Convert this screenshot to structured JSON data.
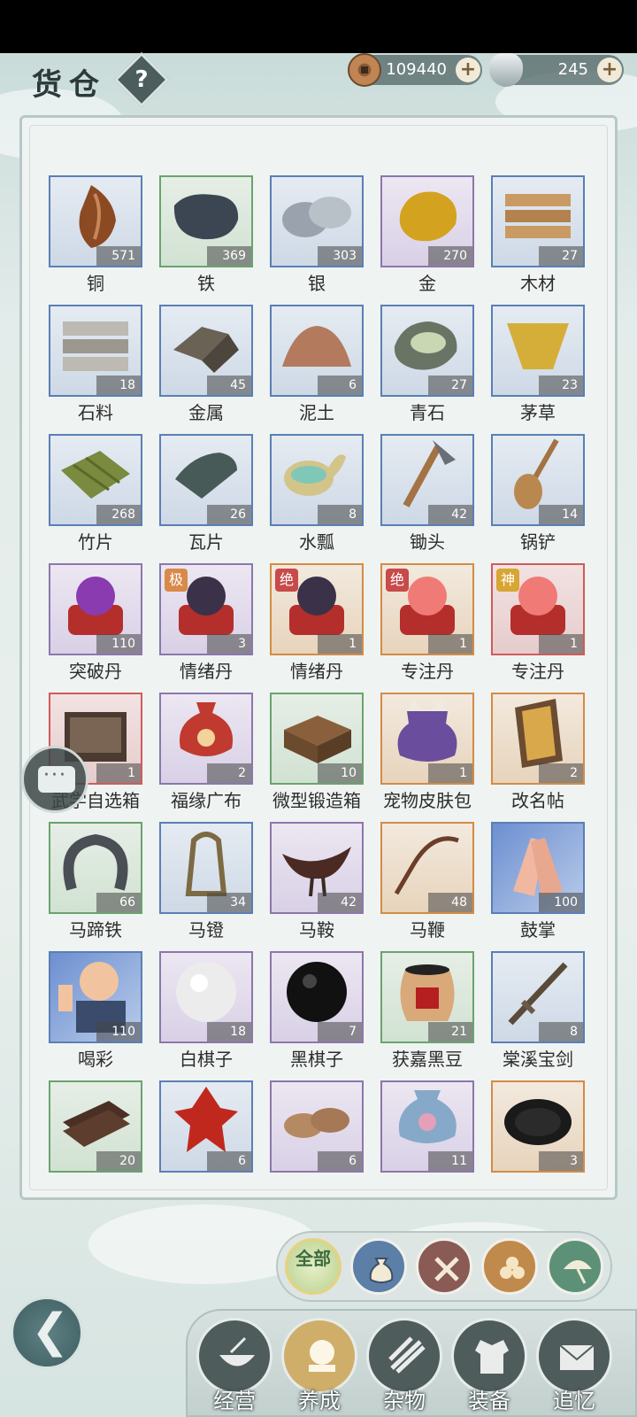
{
  "header": {
    "title": "货仓",
    "help_label": "?"
  },
  "currency": {
    "copper": {
      "icon": "copper-coin-icon",
      "value": "109440"
    },
    "silver": {
      "icon": "silver-ingot-icon",
      "value": "245"
    },
    "plus_label": "+"
  },
  "items": [
    {
      "name": "铜",
      "count": "571",
      "icon": "copper-ore-icon",
      "rarity": "blue"
    },
    {
      "name": "铁",
      "count": "369",
      "icon": "iron-ore-icon",
      "rarity": "green"
    },
    {
      "name": "银",
      "count": "303",
      "icon": "silver-ore-icon",
      "rarity": "blue"
    },
    {
      "name": "金",
      "count": "270",
      "icon": "gold-ore-icon",
      "rarity": "purple"
    },
    {
      "name": "木材",
      "count": "27",
      "icon": "lumber-icon",
      "rarity": "blue"
    },
    {
      "name": "石料",
      "count": "18",
      "icon": "stone-blocks-icon",
      "rarity": "blue"
    },
    {
      "name": "金属",
      "count": "45",
      "icon": "metal-ingot-icon",
      "rarity": "blue"
    },
    {
      "name": "泥土",
      "count": "6",
      "icon": "soil-icon",
      "rarity": "blue"
    },
    {
      "name": "青石",
      "count": "27",
      "icon": "bluestone-icon",
      "rarity": "blue"
    },
    {
      "name": "茅草",
      "count": "23",
      "icon": "thatch-icon",
      "rarity": "blue"
    },
    {
      "name": "竹片",
      "count": "268",
      "icon": "bamboo-slats-icon",
      "rarity": "blue"
    },
    {
      "name": "瓦片",
      "count": "26",
      "icon": "roof-tiles-icon",
      "rarity": "blue"
    },
    {
      "name": "水瓢",
      "count": "8",
      "icon": "water-gourd-icon",
      "rarity": "blue"
    },
    {
      "name": "锄头",
      "count": "42",
      "icon": "hoe-icon",
      "rarity": "blue"
    },
    {
      "name": "锅铲",
      "count": "14",
      "icon": "spatula-icon",
      "rarity": "blue"
    },
    {
      "name": "突破丹",
      "count": "110",
      "icon": "purple-pill-icon",
      "rarity": "purple"
    },
    {
      "name": "情绪丹",
      "count": "3",
      "icon": "dark-pill-icon",
      "rarity": "purple",
      "badge": "极",
      "badge_class": "b-ji"
    },
    {
      "name": "情绪丹",
      "count": "1",
      "icon": "dark-pill-icon",
      "rarity": "orange",
      "badge": "绝",
      "badge_class": "b-jue"
    },
    {
      "name": "专注丹",
      "count": "1",
      "icon": "red-pill-icon",
      "rarity": "orange",
      "badge": "绝",
      "badge_class": "b-jue"
    },
    {
      "name": "专注丹",
      "count": "1",
      "icon": "red-pill-icon",
      "rarity": "red",
      "badge": "神",
      "badge_class": "b-shen"
    },
    {
      "name": "武学自选箱",
      "count": "1",
      "icon": "chest-icon",
      "rarity": "red"
    },
    {
      "name": "福缘广布",
      "count": "2",
      "icon": "fortune-pouch-icon",
      "rarity": "purple"
    },
    {
      "name": "微型锻造箱",
      "count": "10",
      "icon": "forge-box-icon",
      "rarity": "green"
    },
    {
      "name": "宠物皮肤包",
      "count": "1",
      "icon": "pet-skin-bag-icon",
      "rarity": "orange"
    },
    {
      "name": "改名帖",
      "count": "2",
      "icon": "rename-card-icon",
      "rarity": "orange"
    },
    {
      "name": "马蹄铁",
      "count": "66",
      "icon": "horseshoe-icon",
      "rarity": "green"
    },
    {
      "name": "马镫",
      "count": "34",
      "icon": "stirrup-icon",
      "rarity": "blue"
    },
    {
      "name": "马鞍",
      "count": "42",
      "icon": "saddle-icon",
      "rarity": "purple"
    },
    {
      "name": "马鞭",
      "count": "48",
      "icon": "whip-icon",
      "rarity": "orange"
    },
    {
      "name": "鼓掌",
      "count": "100",
      "icon": "clapping-hands-icon",
      "rarity": "hero"
    },
    {
      "name": "喝彩",
      "count": "110",
      "icon": "cheering-person-icon",
      "rarity": "hero"
    },
    {
      "name": "白棋子",
      "count": "18",
      "icon": "white-go-stone-icon",
      "rarity": "purple"
    },
    {
      "name": "黑棋子",
      "count": "7",
      "icon": "black-go-stone-icon",
      "rarity": "purple"
    },
    {
      "name": "获嘉黑豆",
      "count": "21",
      "icon": "black-bean-jar-icon",
      "rarity": "green"
    },
    {
      "name": "棠溪宝剑",
      "count": "8",
      "icon": "sword-icon",
      "rarity": "blue"
    },
    {
      "name": "",
      "count": "20",
      "icon": "chocolate-bars-icon",
      "rarity": "green"
    },
    {
      "name": "",
      "count": "6",
      "icon": "paper-cut-icon",
      "rarity": "blue"
    },
    {
      "name": "",
      "count": "6",
      "icon": "straw-sandals-icon",
      "rarity": "purple"
    },
    {
      "name": "",
      "count": "11",
      "icon": "embroidered-pouch-icon",
      "rarity": "purple"
    },
    {
      "name": "",
      "count": "3",
      "icon": "inkstone-icon",
      "rarity": "orange"
    }
  ],
  "filters": [
    {
      "label": "全部",
      "icon": "all-icon",
      "active": true
    },
    {
      "label": "",
      "icon": "bag-icon"
    },
    {
      "label": "",
      "icon": "tools-icon"
    },
    {
      "label": "",
      "icon": "logs-icon"
    },
    {
      "label": "",
      "icon": "umbrella-icon"
    }
  ],
  "nav": [
    {
      "label": "经营",
      "icon": "cooking-bowl-icon"
    },
    {
      "label": "养成",
      "icon": "pearl-icon",
      "active": true
    },
    {
      "label": "杂物",
      "icon": "bundle-icon"
    },
    {
      "label": "装备",
      "icon": "armor-icon"
    },
    {
      "label": "追忆",
      "icon": "letter-icon"
    }
  ]
}
